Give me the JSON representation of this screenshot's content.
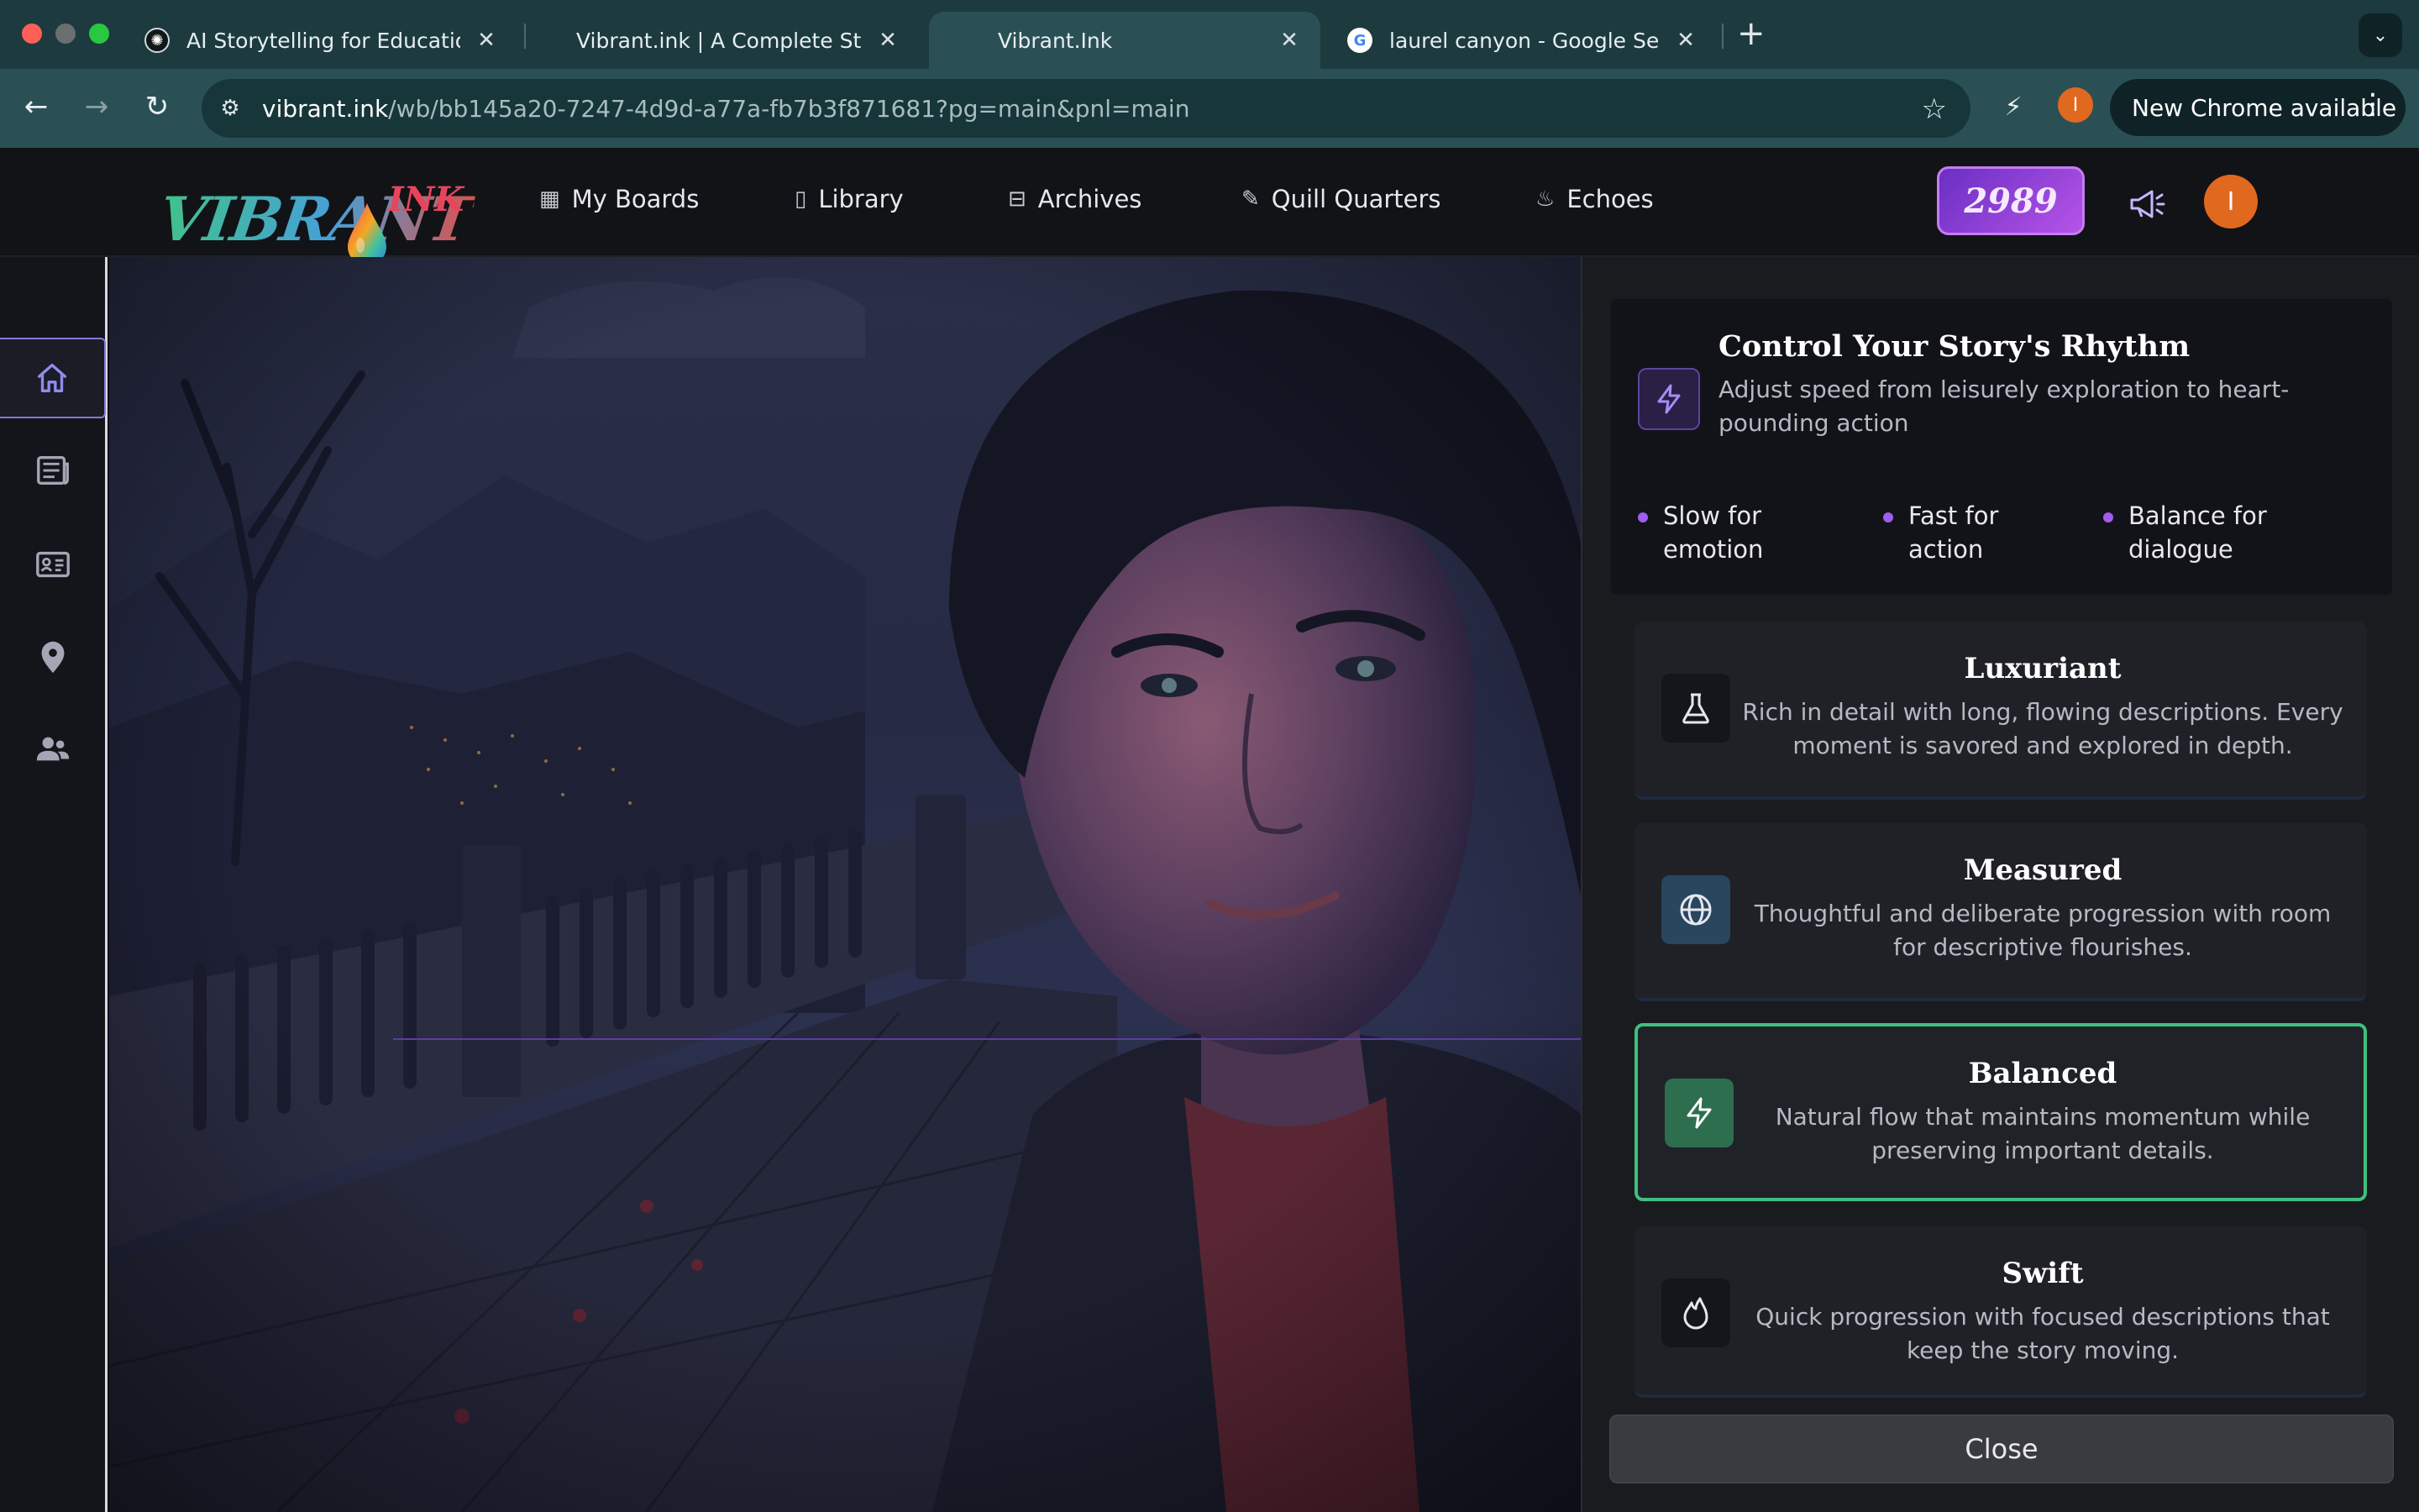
{
  "browser": {
    "tabs": [
      {
        "title": "AI Storytelling for Education",
        "favicon": "openai-icon",
        "active": false
      },
      {
        "title": "Vibrant.ink | A Complete Story",
        "favicon": "vibrant-icon",
        "active": false
      },
      {
        "title": "Vibrant.Ink",
        "favicon": "vibrant-icon",
        "active": true
      },
      {
        "title": "laurel canyon - Google Search",
        "favicon": "google-icon",
        "active": false
      }
    ],
    "close_glyph": "✕",
    "new_tab_glyph": "+",
    "url_host": "vibrant.ink",
    "url_path": "/wb/bb145a20-7247-4d9d-a77a-fb7b3f871681?pg=main&pnl=main",
    "profile_initial": "I",
    "update_label": "New Chrome available"
  },
  "app": {
    "logo_text": "VIBRANT",
    "logo_suffix": "INK",
    "nav": [
      {
        "label": "My Boards",
        "icon": "grid-icon"
      },
      {
        "label": "Library",
        "icon": "book-icon"
      },
      {
        "label": "Archives",
        "icon": "archive-icon"
      },
      {
        "label": "Quill Quarters",
        "icon": "pencil-icon"
      },
      {
        "label": "Echoes",
        "icon": "flame-icon"
      }
    ],
    "credits": "2989",
    "avatar_initial": "I"
  },
  "rail": [
    {
      "icon": "home-icon",
      "active": true
    },
    {
      "icon": "newspaper-icon",
      "active": false
    },
    {
      "icon": "id-card-icon",
      "active": false
    },
    {
      "icon": "map-pin-icon",
      "active": false
    },
    {
      "icon": "users-icon",
      "active": false
    }
  ],
  "panel": {
    "title": "Control Your Story's Rhythm",
    "description": "Adjust speed from leisurely exploration to heart-pounding action",
    "tips": [
      "Slow for emotion",
      "Fast for action",
      "Balance for dialogue"
    ],
    "options": [
      {
        "title": "Luxuriant",
        "description": "Rich in detail with long, flowing descriptions. Every moment is savored and explored in depth.",
        "icon": "flask-icon",
        "selected": false
      },
      {
        "title": "Measured",
        "description": "Thoughtful and deliberate progression with room for descriptive flourishes.",
        "icon": "globe-icon",
        "selected": false
      },
      {
        "title": "Balanced",
        "description": "Natural flow that maintains momentum while preserving important details.",
        "icon": "lightning-icon",
        "selected": true
      },
      {
        "title": "Swift",
        "description": "Quick progression with focused descriptions that keep the story moving.",
        "icon": "flame-icon",
        "selected": false
      }
    ],
    "close_label": "Close"
  },
  "colors": {
    "accent_purple": "#a25cf0",
    "selected_green": "#3fbf80",
    "chrome_teal": "#2a5055"
  }
}
